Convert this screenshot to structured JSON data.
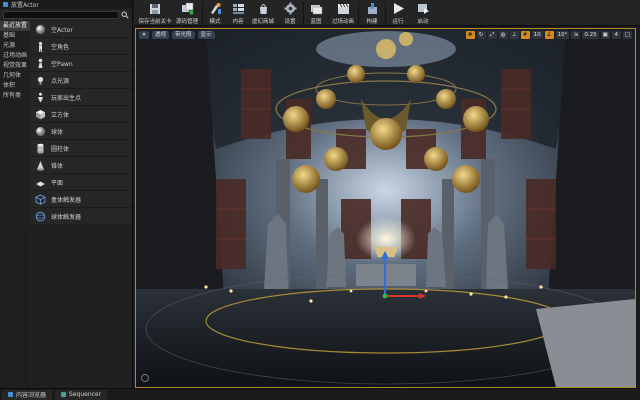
{
  "place_actors": {
    "tab_title": "放置Actor",
    "search_placeholder": "",
    "categories": [
      "最近放置",
      "基础",
      "光源",
      "过场动画",
      "视觉效果",
      "几何体",
      "体积",
      "所有类"
    ],
    "actors": [
      {
        "label": "空Actor",
        "icon": "sphere-icon"
      },
      {
        "label": "空角色",
        "icon": "character-icon"
      },
      {
        "label": "空Pawn",
        "icon": "pawn-icon"
      },
      {
        "label": "点光源",
        "icon": "point-light-icon"
      },
      {
        "label": "玩家出生点",
        "icon": "player-start-icon"
      },
      {
        "label": "立方体",
        "icon": "cube-icon"
      },
      {
        "label": "球体",
        "icon": "sphere-icon"
      },
      {
        "label": "圆柱体",
        "icon": "cylinder-icon"
      },
      {
        "label": "锥体",
        "icon": "cone-icon"
      },
      {
        "label": "平面",
        "icon": "plane-icon"
      },
      {
        "label": "盒体触发器",
        "icon": "box-trigger-icon"
      },
      {
        "label": "球体触发器",
        "icon": "sphere-trigger-icon"
      }
    ]
  },
  "toolbar": {
    "items": [
      {
        "label": "保存当前关卡",
        "icon": "save-icon"
      },
      {
        "label": "源码管理",
        "icon": "source-control-icon"
      },
      {
        "label": "模式",
        "icon": "modes-icon"
      },
      {
        "label": "内容",
        "icon": "content-icon"
      },
      {
        "label": "虚幻商城",
        "icon": "marketplace-icon"
      },
      {
        "label": "设置",
        "icon": "settings-icon"
      },
      {
        "label": "蓝图",
        "icon": "blueprint-icon"
      },
      {
        "label": "过场动画",
        "icon": "cinematics-icon"
      },
      {
        "label": "构建",
        "icon": "build-icon"
      },
      {
        "label": "运行",
        "icon": "play-icon"
      },
      {
        "label": "启动",
        "icon": "launch-icon"
      }
    ]
  },
  "viewport": {
    "perspective_label": "透视",
    "lit_label": "带光照",
    "show_label": "显示",
    "grid_snap": "10",
    "rotation_snap": "10°",
    "scale_snap": "0.25",
    "camera_speed": "4",
    "accent_color": "#d68a1c"
  },
  "bottom_tabs": [
    {
      "label": "内容浏览器",
      "color": "#4a8fd6"
    },
    {
      "label": "Sequencer",
      "color": "#4aa0a0"
    }
  ]
}
